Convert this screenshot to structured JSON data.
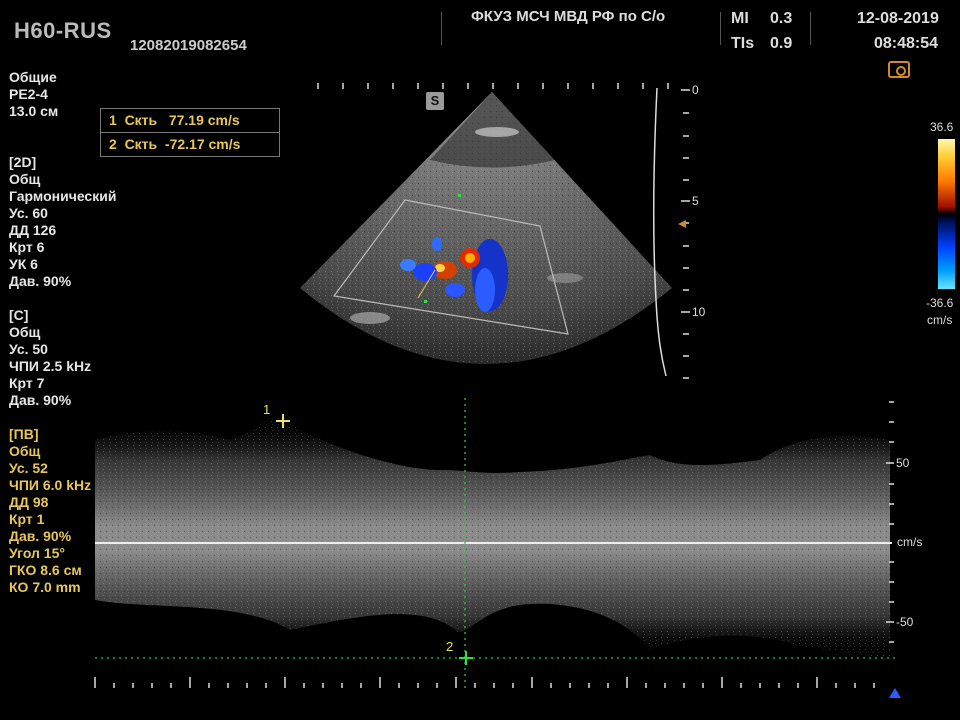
{
  "header": {
    "brand": "H60-RUS",
    "study_id": "12082019082654",
    "institution": "ФКУЗ МСЧ МВД РФ по С/о",
    "mi_label": "MI",
    "mi_value": "0.3",
    "tis_label": "TIs",
    "tis_value": "0.9",
    "date": "12-08-2019",
    "time": "08:48:54"
  },
  "probe": {
    "lines": [
      "Общие",
      "PE2-4",
      "13.0 см"
    ]
  },
  "mode_2d": {
    "lines": [
      "[2D]",
      "Общ",
      "Гармонический",
      "Ус.  60",
      "ДД  126",
      "Крт 6",
      "УК  6",
      "Дав. 90%"
    ]
  },
  "mode_color": {
    "lines": [
      "[C]",
      "Общ",
      "Ус.  50",
      "ЧПИ 2.5 kHz",
      "Крт 7",
      "Дав. 90%"
    ]
  },
  "mode_pw": {
    "lines": [
      "[ПВ]",
      "Общ",
      "Ус.  52",
      "ЧПИ 6.0 kHz",
      "ДД  98",
      "Крт 1",
      "Дав. 90%",
      "Угол 15°",
      "ГКО 8.6 см",
      "КО  7.0 mm"
    ]
  },
  "measurements": [
    {
      "text": "1  Скть   77.19 cm/s"
    },
    {
      "text": "2  Скть  -72.17 cm/s"
    }
  ],
  "color_scale": {
    "top": "36.6",
    "bottom": "-36.6",
    "unit": "cm/s"
  },
  "orientation_mark": "S",
  "depth_scale": {
    "labels": [
      "0",
      "5",
      "10"
    ]
  },
  "velocity_scale": {
    "top": "50",
    "unit": "cm/s",
    "bottom": "-50"
  },
  "calipers": {
    "one": "1",
    "two": "2"
  },
  "colors": {
    "accent_yellow": "#e8c75a",
    "caliper_green": "#22cc44",
    "text": "#e6e6e6"
  }
}
